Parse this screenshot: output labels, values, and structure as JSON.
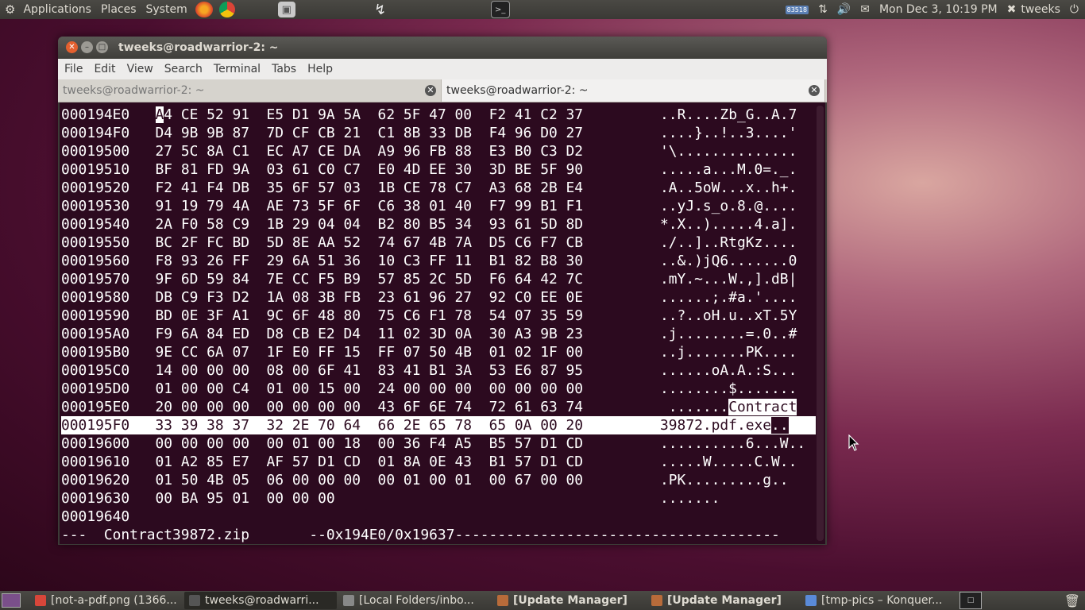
{
  "top_panel": {
    "menus": [
      "Applications",
      "Places",
      "System"
    ],
    "clock": "Mon Dec 3, 10:19 PM",
    "user": "tweeks",
    "net_badge": "83518"
  },
  "window": {
    "title": "tweeks@roadwarrior-2: ~",
    "menu": [
      "File",
      "Edit",
      "View",
      "Search",
      "Terminal",
      "Tabs",
      "Help"
    ],
    "tabs": [
      {
        "label": "tweeks@roadwarrior-2: ~"
      },
      {
        "label": "tweeks@roadwarrior-2: ~"
      }
    ]
  },
  "hexdump": {
    "rows": [
      {
        "addr": "000194E0",
        "hex": "A4 CE 52 91  E5 D1 9A 5A  62 5F 47 00  F2 41 C2 37",
        "ascii": "..R....Zb_G..A.7"
      },
      {
        "addr": "000194F0",
        "hex": "D4 9B 9B 87  7D CF CB 21  C1 8B 33 DB  F4 96 D0 27",
        "ascii": "....}..!..3....'"
      },
      {
        "addr": "00019500",
        "hex": "27 5C 8A C1  EC A7 CE DA  A9 96 FB 88  E3 B0 C3 D2",
        "ascii": "'\\.............."
      },
      {
        "addr": "00019510",
        "hex": "BF 81 FD 9A  03 61 C0 C7  E0 4D EE 30  3D BE 5F 90",
        "ascii": ".....a...M.0=._."
      },
      {
        "addr": "00019520",
        "hex": "F2 41 F4 DB  35 6F 57 03  1B CE 78 C7  A3 68 2B E4",
        "ascii": ".A..5oW...x..h+."
      },
      {
        "addr": "00019530",
        "hex": "91 19 79 4A  AE 73 5F 6F  C6 38 01 40  F7 99 B1 F1",
        "ascii": "..yJ.s_o.8.@...."
      },
      {
        "addr": "00019540",
        "hex": "2A F0 58 C9  1B 29 04 04  B2 80 B5 34  93 61 5D 8D",
        "ascii": "*.X..).....4.a]."
      },
      {
        "addr": "00019550",
        "hex": "BC 2F FC BD  5D 8E AA 52  74 67 4B 7A  D5 C6 F7 CB",
        "ascii": "./..]..RtgKz...."
      },
      {
        "addr": "00019560",
        "hex": "F8 93 26 FF  29 6A 51 36  10 C3 FF 11  B1 82 B8 30",
        "ascii": "..&.)jQ6.......0"
      },
      {
        "addr": "00019570",
        "hex": "9F 6D 59 84  7E CC F5 B9  57 85 2C 5D  F6 64 42 7C",
        "ascii": ".mY.~...W.,].dB|"
      },
      {
        "addr": "00019580",
        "hex": "DB C9 F3 D2  1A 08 3B FB  23 61 96 27  92 C0 EE 0E",
        "ascii": "......;.#a.'...."
      },
      {
        "addr": "00019590",
        "hex": "BD 0E 3F A1  9C 6F 48 80  75 C6 F1 78  54 07 35 59",
        "ascii": "..?..oH.u..xT.5Y"
      },
      {
        "addr": "000195A0",
        "hex": "F9 6A 84 ED  D8 CB E2 D4  11 02 3D 0A  30 A3 9B 23",
        "ascii": ".j........=.0..#"
      },
      {
        "addr": "000195B0",
        "hex": "9E CC 6A 07  1F E0 FF 15  FF 07 50 4B  01 02 1F 00",
        "ascii": "..j.......PK...."
      },
      {
        "addr": "000195C0",
        "hex": "14 00 00 00  08 00 6F 41  83 41 B1 3A  53 E6 87 95",
        "ascii": "......oA.A.:S..."
      },
      {
        "addr": "000195D0",
        "hex": "01 00 00 C4  01 00 15 00  24 00 00 00  00 00 00 00",
        "ascii": "........$......."
      },
      {
        "addr": "000195E0",
        "hex": "20 00 00 00  00 00 00 00  43 6F 6E 74  72 61 63 74",
        "ascii": " .......",
        "ascii_hl": "Contract"
      },
      {
        "addr": "000195F0",
        "hex": "33 39 38 37  32 2E 70 64  66 2E 65 78  65 0A 00 20",
        "ascii": "39872.pdf.exe",
        "ascii_tail": "..",
        "selected": true
      },
      {
        "addr": "00019600",
        "hex": "00 00 00 00  00 01 00 18  00 36 F4 A5  B5 57 D1 CD",
        "ascii": "..........6...W.."
      },
      {
        "addr": "00019610",
        "hex": "01 A2 85 E7  AF 57 D1 CD  01 8A 0E 43  B1 57 D1 CD",
        "ascii": ".....W.....C.W.."
      },
      {
        "addr": "00019620",
        "hex": "01 50 4B 05  06 00 00 00  00 01 00 01  00 67 00 00",
        "ascii": ".PK.........g.."
      },
      {
        "addr": "00019630",
        "hex": "00 BA 95 01  00 00 00",
        "ascii": "......."
      },
      {
        "addr": "00019640",
        "hex": "",
        "ascii": ""
      }
    ],
    "status": "---  Contract39872.zip       --0x194E0/0x19637--------------------------------------"
  },
  "taskbar": {
    "items": [
      {
        "label": "[not-a-pdf.png (1366...",
        "bold": false,
        "color": "#d8463a"
      },
      {
        "label": "tweeks@roadwarri...",
        "bold": false,
        "color": "#555555",
        "active": true
      },
      {
        "label": "[Local Folders/inbo...",
        "bold": false,
        "color": "#888888"
      },
      {
        "label": "[Update Manager]",
        "bold": true,
        "color": "#b86b3a"
      },
      {
        "label": "[Update Manager]",
        "bold": true,
        "color": "#b86b3a"
      },
      {
        "label": "[tmp-pics – Konquer...",
        "bold": false,
        "color": "#5a8ad8"
      }
    ]
  }
}
